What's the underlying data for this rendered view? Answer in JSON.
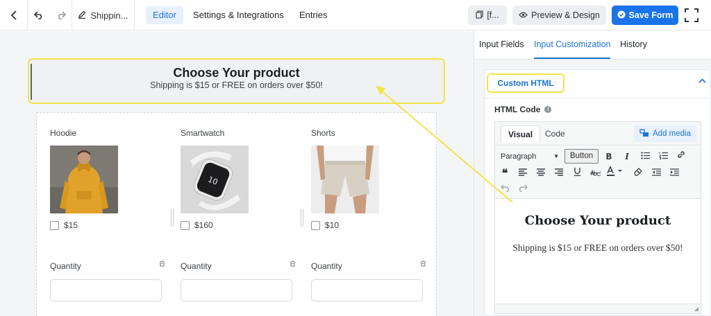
{
  "topbar": {
    "form_title": "Shippin...",
    "nav": [
      "Editor",
      "Settings & Integrations",
      "Entries"
    ],
    "shortcode_label": "[f...",
    "preview_label": "Preview & Design",
    "save_label": "Save Form"
  },
  "canvas": {
    "header_title": "Choose Your product",
    "header_subtitle": "Shipping is $15 or FREE on orders over $50!",
    "products": [
      {
        "name": "Hoodie",
        "price": "$15",
        "quantity_label": "Quantity"
      },
      {
        "name": "Smartwatch",
        "price": "$160",
        "quantity_label": "Quantity"
      },
      {
        "name": "Shorts",
        "price": "$10",
        "quantity_label": "Quantity"
      }
    ]
  },
  "panel": {
    "tabs": [
      "Input Fields",
      "Input Customization",
      "History"
    ],
    "section_title": "Custom HTML",
    "html_code_label": "HTML Code",
    "editor": {
      "tab_visual": "Visual",
      "tab_code": "Code",
      "add_media": "Add media",
      "paragraph_select": "Paragraph",
      "button_label": "Button",
      "content_heading": "Choose Your product",
      "content_text": "Shipping is $15 or FREE on orders over $50!"
    }
  },
  "colors": {
    "accent": "#1a73e8",
    "highlight": "#f1e44a"
  }
}
